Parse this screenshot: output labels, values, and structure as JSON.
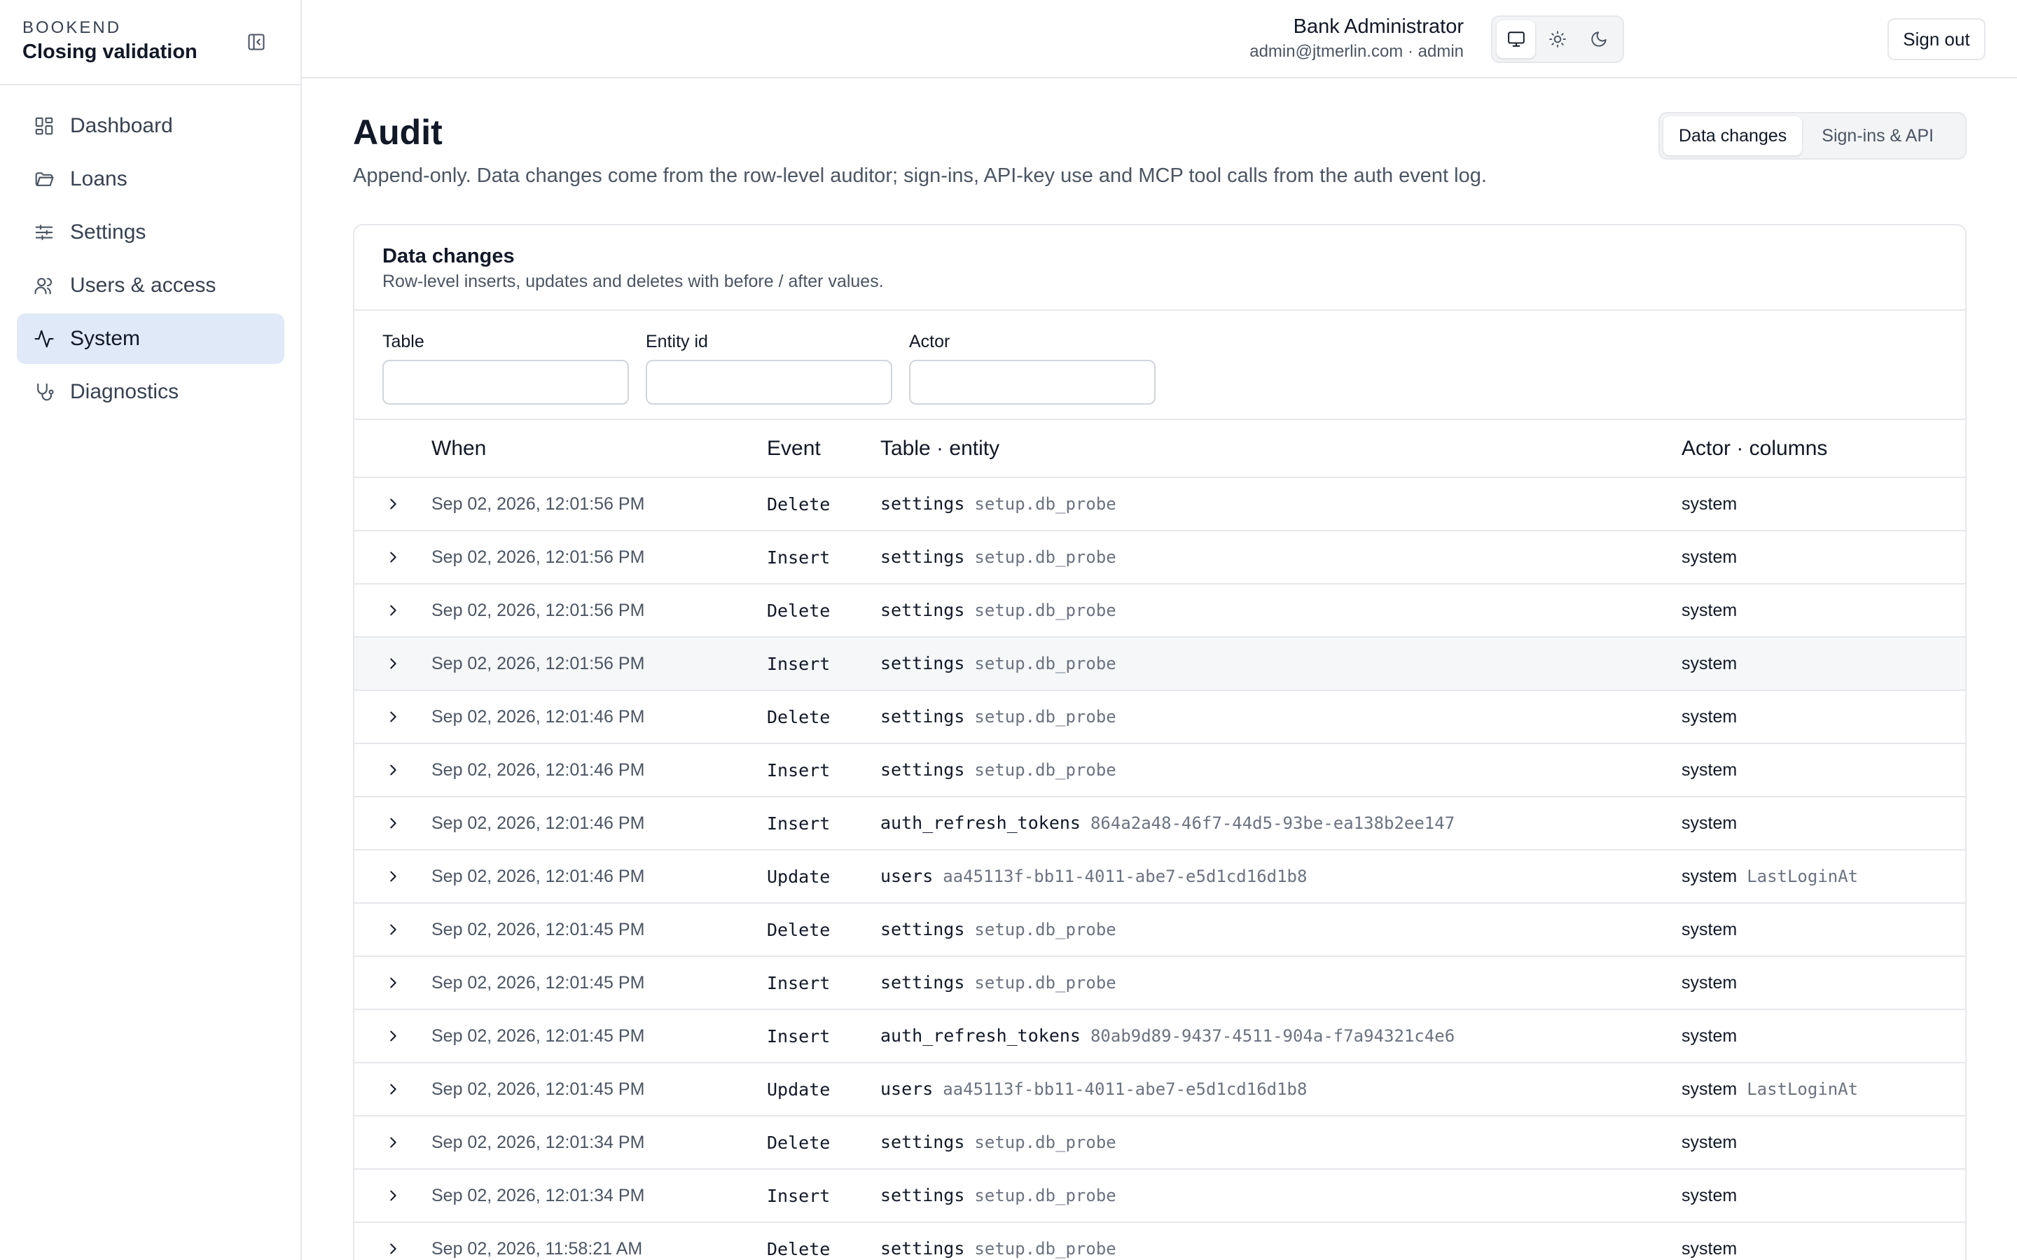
{
  "sidebar": {
    "eyebrow": "BOOKEND",
    "title": "Closing validation",
    "items": [
      {
        "label": "Dashboard",
        "icon": "dashboard-icon",
        "active": false
      },
      {
        "label": "Loans",
        "icon": "folder-icon",
        "active": false
      },
      {
        "label": "Settings",
        "icon": "sliders-icon",
        "active": false
      },
      {
        "label": "Users & access",
        "icon": "users-icon",
        "active": false
      },
      {
        "label": "System",
        "icon": "activity-icon",
        "active": true
      },
      {
        "label": "Diagnostics",
        "icon": "stethoscope-icon",
        "active": false
      }
    ]
  },
  "header": {
    "user_name": "Bank Administrator",
    "user_sub": "admin@jtmerlin.com · admin",
    "sign_out": "Sign out",
    "theme_selected": "system"
  },
  "page": {
    "title": "Audit",
    "description": "Append-only. Data changes come from the row-level auditor; sign-ins, API-key use and MCP tool calls from the auth event log.",
    "tabs": [
      {
        "label": "Data changes",
        "active": true
      },
      {
        "label": "Sign-ins & API",
        "active": false
      }
    ]
  },
  "card": {
    "title": "Data changes",
    "subtitle": "Row-level inserts, updates and deletes with before / after values.",
    "filters": [
      {
        "label": "Table",
        "value": ""
      },
      {
        "label": "Entity id",
        "value": ""
      },
      {
        "label": "Actor",
        "value": ""
      }
    ],
    "columns": {
      "when": "When",
      "event": "Event",
      "table_entity": "Table · entity",
      "actor_columns": "Actor · columns"
    },
    "rows": [
      {
        "when": "Sep 02, 2026, 12:01:56 PM",
        "event": "Delete",
        "table": "settings",
        "entity": "setup.db_probe",
        "actor": "system",
        "columns": ""
      },
      {
        "when": "Sep 02, 2026, 12:01:56 PM",
        "event": "Insert",
        "table": "settings",
        "entity": "setup.db_probe",
        "actor": "system",
        "columns": ""
      },
      {
        "when": "Sep 02, 2026, 12:01:56 PM",
        "event": "Delete",
        "table": "settings",
        "entity": "setup.db_probe",
        "actor": "system",
        "columns": ""
      },
      {
        "when": "Sep 02, 2026, 12:01:56 PM",
        "event": "Insert",
        "table": "settings",
        "entity": "setup.db_probe",
        "actor": "system",
        "columns": ""
      },
      {
        "when": "Sep 02, 2026, 12:01:46 PM",
        "event": "Delete",
        "table": "settings",
        "entity": "setup.db_probe",
        "actor": "system",
        "columns": ""
      },
      {
        "when": "Sep 02, 2026, 12:01:46 PM",
        "event": "Insert",
        "table": "settings",
        "entity": "setup.db_probe",
        "actor": "system",
        "columns": ""
      },
      {
        "when": "Sep 02, 2026, 12:01:46 PM",
        "event": "Insert",
        "table": "auth_refresh_tokens",
        "entity": "864a2a48-46f7-44d5-93be-ea138b2ee147",
        "actor": "system",
        "columns": ""
      },
      {
        "when": "Sep 02, 2026, 12:01:46 PM",
        "event": "Update",
        "table": "users",
        "entity": "aa45113f-bb11-4011-abe7-e5d1cd16d1b8",
        "actor": "system",
        "columns": "LastLoginAt"
      },
      {
        "when": "Sep 02, 2026, 12:01:45 PM",
        "event": "Delete",
        "table": "settings",
        "entity": "setup.db_probe",
        "actor": "system",
        "columns": ""
      },
      {
        "when": "Sep 02, 2026, 12:01:45 PM",
        "event": "Insert",
        "table": "settings",
        "entity": "setup.db_probe",
        "actor": "system",
        "columns": ""
      },
      {
        "when": "Sep 02, 2026, 12:01:45 PM",
        "event": "Insert",
        "table": "auth_refresh_tokens",
        "entity": "80ab9d89-9437-4511-904a-f7a94321c4e6",
        "actor": "system",
        "columns": ""
      },
      {
        "when": "Sep 02, 2026, 12:01:45 PM",
        "event": "Update",
        "table": "users",
        "entity": "aa45113f-bb11-4011-abe7-e5d1cd16d1b8",
        "actor": "system",
        "columns": "LastLoginAt"
      },
      {
        "when": "Sep 02, 2026, 12:01:34 PM",
        "event": "Delete",
        "table": "settings",
        "entity": "setup.db_probe",
        "actor": "system",
        "columns": ""
      },
      {
        "when": "Sep 02, 2026, 12:01:34 PM",
        "event": "Insert",
        "table": "settings",
        "entity": "setup.db_probe",
        "actor": "system",
        "columns": ""
      },
      {
        "when": "Sep 02, 2026, 11:58:21 AM",
        "event": "Delete",
        "table": "settings",
        "entity": "setup.db_probe",
        "actor": "system",
        "columns": ""
      }
    ]
  }
}
